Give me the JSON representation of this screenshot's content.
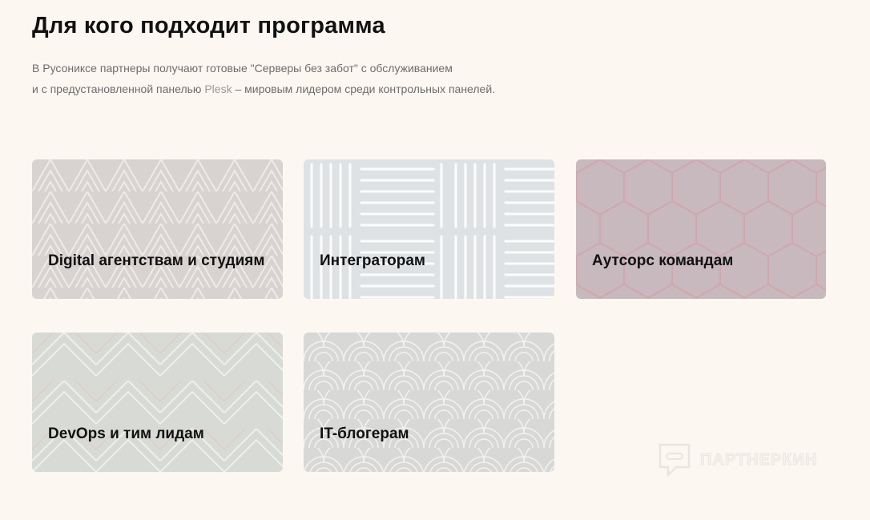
{
  "header": {
    "title": "Для кого подходит программа",
    "desc_line1": "В Русониксе партнеры получают готовые \"Серверы без забот\" с обслуживанием",
    "desc_line2_start": "и с предустановленной панелью ",
    "desc_line2_plesk": "Plesk",
    "desc_line2_end": " – мировым лидером среди контрольных панелей."
  },
  "cards": [
    {
      "label": "Digital агентствам и студиям",
      "pattern": "triangles"
    },
    {
      "label": "Интеграторам",
      "pattern": "stripes-grid"
    },
    {
      "label": "Аутсорс командам",
      "pattern": "hexagons"
    },
    {
      "label": "DevOps и тим лидам",
      "pattern": "chevrons"
    },
    {
      "label": "IT-блогерам",
      "pattern": "arcs"
    }
  ],
  "watermark": {
    "text": "ПАРТНЕРКИН",
    "icon": "chat-bubble-icon"
  },
  "colors": {
    "background": "#fcf7f1",
    "title": "#111111",
    "description": "#6d6d6d"
  }
}
